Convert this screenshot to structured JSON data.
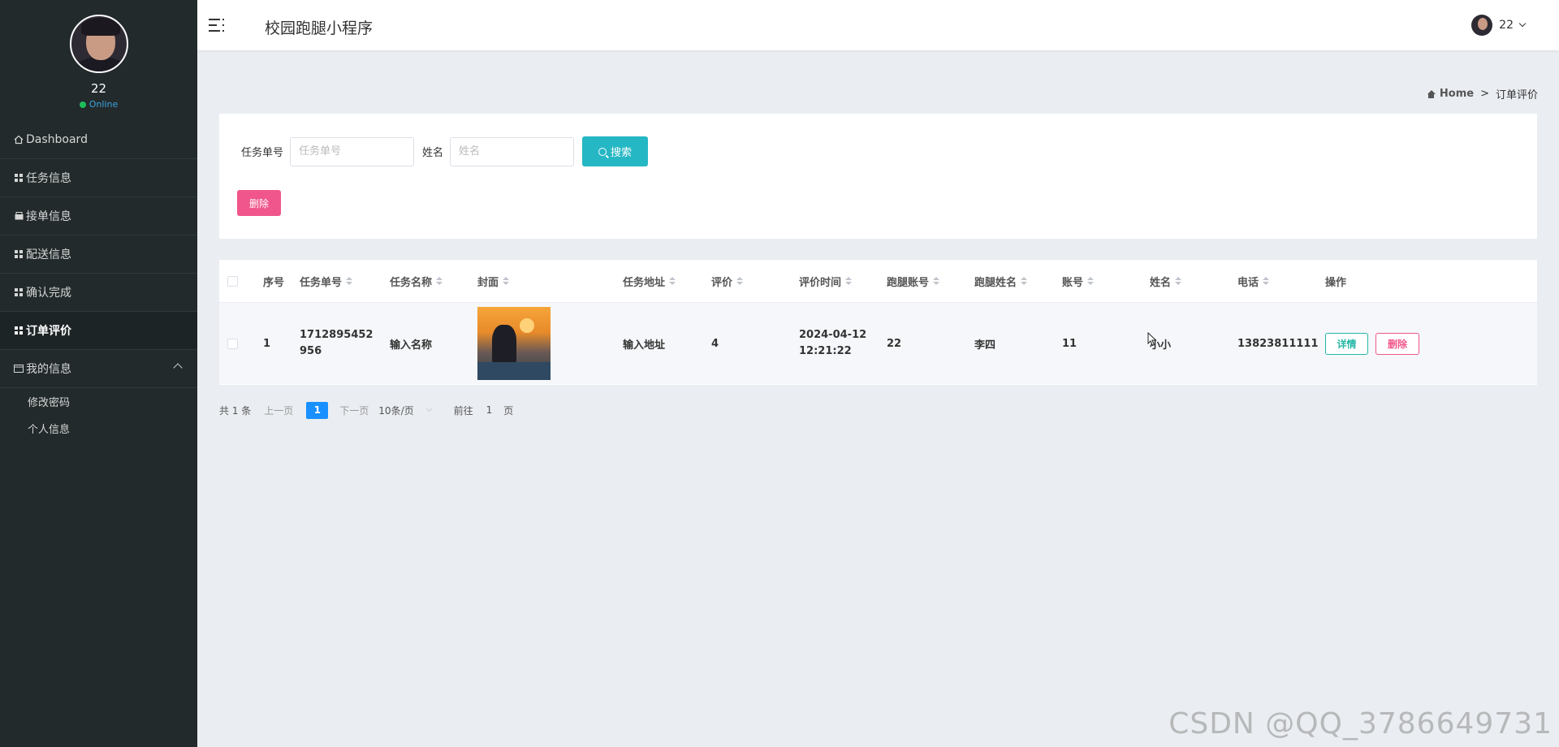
{
  "sidebar": {
    "user_name": "22",
    "status": "Online",
    "items": [
      {
        "label": "Dashboard",
        "icon": "home-icon",
        "active": false
      },
      {
        "label": "任务信息",
        "icon": "grid-icon",
        "active": false
      },
      {
        "label": "接单信息",
        "icon": "inbox-icon",
        "active": false
      },
      {
        "label": "配送信息",
        "icon": "grid-icon",
        "active": false
      },
      {
        "label": "确认完成",
        "icon": "grid-icon",
        "active": false
      },
      {
        "label": "订单评价",
        "icon": "grid-icon",
        "active": true
      },
      {
        "label": "我的信息",
        "icon": "id-card-icon",
        "active": false,
        "expanded": true
      }
    ],
    "subitems": [
      {
        "label": "修改密码"
      },
      {
        "label": "个人信息"
      }
    ]
  },
  "header": {
    "title": "校园跑腿小程序",
    "user_name": "22"
  },
  "breadcrumb": {
    "home": "Home",
    "separator": ">",
    "current": "订单评价"
  },
  "search": {
    "task_no_label": "任务单号",
    "task_no_placeholder": "任务单号",
    "name_label": "姓名",
    "name_placeholder": "姓名",
    "search_button": "搜索",
    "delete_button": "删除"
  },
  "table": {
    "columns": [
      "序号",
      "任务单号",
      "任务名称",
      "封面",
      "任务地址",
      "评价",
      "评价时间",
      "跑腿账号",
      "跑腿姓名",
      "账号",
      "姓名",
      "电话",
      "操作"
    ],
    "rows": [
      {
        "index": "1",
        "task_no": "1712895452956",
        "task_name": "输入名称",
        "address": "输入地址",
        "rating": "4",
        "time": "2024-04-12 12:21:22",
        "runner_account": "22",
        "runner_name": "李四",
        "account": "11",
        "name": "小小",
        "phone": "13823811111",
        "detail_button": "详情",
        "delete_button": "删除"
      }
    ]
  },
  "pagination": {
    "total": "共 1 条",
    "prev": "上一页",
    "current": "1",
    "next": "下一页",
    "page_size": "10条/页",
    "goto_label": "前往",
    "goto_value": "1",
    "page_suffix": "页"
  },
  "watermark": "CSDN @QQ_3786649731",
  "colors": {
    "sidebar_bg": "#222a2b",
    "accent_teal": "#26b7c4",
    "danger_pink": "#f0568b",
    "page_active": "#1890ff"
  }
}
